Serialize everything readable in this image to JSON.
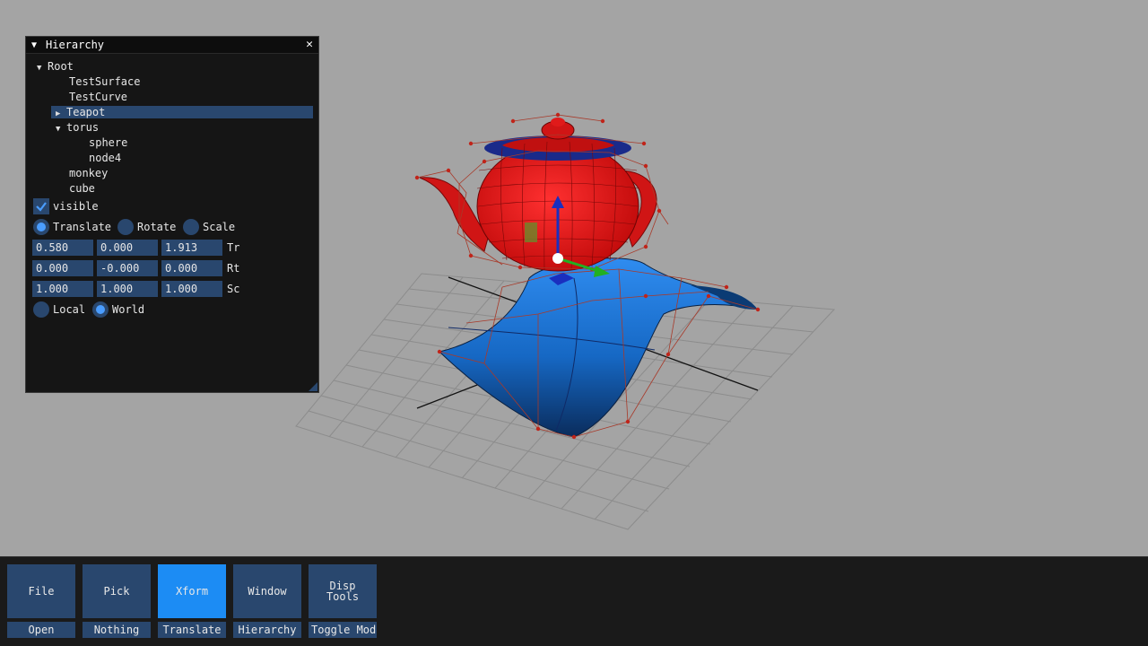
{
  "hierarchy": {
    "title": "Hierarchy",
    "nodes": [
      "Root",
      "TestSurface",
      "TestCurve",
      "Teapot",
      "torus",
      "sphere",
      "node4",
      "monkey",
      "cube"
    ],
    "visible_label": "visible",
    "visible_checked": true,
    "mode_options": [
      "Translate",
      "Rotate",
      "Scale"
    ],
    "mode_selected": "Translate",
    "translate": [
      "0.580",
      "0.000",
      "1.913"
    ],
    "rotate": [
      "0.000",
      "-0.000",
      "0.000"
    ],
    "scale": [
      "1.000",
      "1.000",
      "1.000"
    ],
    "row_labels": [
      "Tr",
      "Rt",
      "Sc"
    ],
    "space_options": [
      "Local",
      "World"
    ],
    "space_selected": "World"
  },
  "toolbar": {
    "buttons": [
      {
        "label": "File",
        "sub": "Open"
      },
      {
        "label": "Pick",
        "sub": "Nothing"
      },
      {
        "label": "Xform",
        "sub": "Translate"
      },
      {
        "label": "Window",
        "sub": "Hierarchy"
      },
      {
        "label": "Disp Tools",
        "sub": "Toggle Mode"
      }
    ],
    "active": "Xform"
  },
  "colors": {
    "background": "#a4a4a4",
    "panel": "#151515",
    "widget": "#29476e",
    "active": "#1c8cf4",
    "teapot": "#e8161a",
    "surface": "#1f7ce0",
    "control_cage": "#a83a2a"
  },
  "icons": [
    "collapse-triangle-icon",
    "close-icon",
    "expand-arrow-icon",
    "checkmark-icon",
    "resize-grip-icon"
  ]
}
